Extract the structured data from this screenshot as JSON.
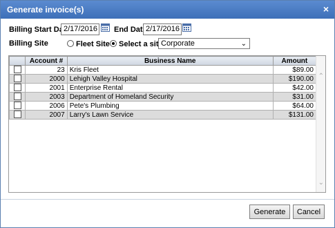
{
  "dialog": {
    "title": "Generate invoice(s)",
    "close_glyph": "×"
  },
  "filters": {
    "billing_start_label": "Billing Start Date",
    "billing_start_value": "2/17/2016",
    "end_date_label": "End Date",
    "end_date_value": "2/17/2016",
    "billing_site_label": "Billing Site",
    "fleet_site_label": "Fleet Site",
    "select_site_label": "Select a site",
    "site_selected": "Corporate"
  },
  "grid": {
    "columns": [
      "",
      "Account #",
      "Business Name",
      "Amount"
    ],
    "rows": [
      {
        "account": "23",
        "name": "Kris Fleet",
        "amount": "$89.00"
      },
      {
        "account": "2000",
        "name": "Lehigh Valley Hospital",
        "amount": "$190.00"
      },
      {
        "account": "2001",
        "name": "Enterprise Rental",
        "amount": "$42.00"
      },
      {
        "account": "2003",
        "name": "Department of Homeland Security",
        "amount": "$31.00"
      },
      {
        "account": "2006",
        "name": "Pete's Plumbing",
        "amount": "$64.00"
      },
      {
        "account": "2007",
        "name": "Larry's Lawn Service",
        "amount": "$131.00"
      }
    ]
  },
  "buttons": {
    "generate": "Generate",
    "cancel": "Cancel"
  },
  "colors": {
    "title_bar": "#3d6fb8",
    "row_alt": "#dcdcdc"
  }
}
